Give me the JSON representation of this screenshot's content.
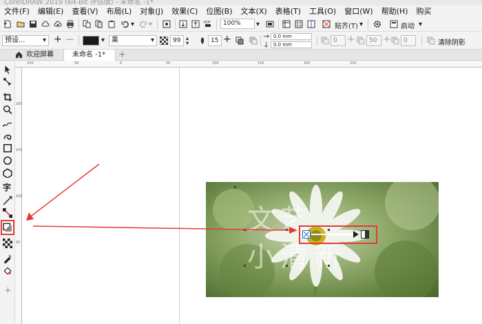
{
  "window": {
    "title": "CorelDRAW 2019 (64-Bit 评估版) - 未命名 -1*"
  },
  "menu": {
    "items": [
      "文件(F)",
      "编辑(E)",
      "查看(V)",
      "布局(L)",
      "对象(J)",
      "效果(C)",
      "位图(B)",
      "文本(X)",
      "表格(T)",
      "工具(O)",
      "窗口(W)",
      "帮助(H)",
      "购买"
    ]
  },
  "toolbar": {
    "zoom_value": "100%",
    "snap_label": "贴齐(T)",
    "launch_label": "启动"
  },
  "properties": {
    "preset_value": "预设...",
    "preset_add_symbol": "+",
    "preset_remove_symbol": "—",
    "direction_value": "乘",
    "opacity_value": "99",
    "feather_value": "15",
    "offset_x": "0.0 mm",
    "offset_y": "0.0 mm",
    "stretch_value": "0",
    "fade_value": "50",
    "extra_value": "0",
    "clear_shadow_label": "清除阴影"
  },
  "tabs": [
    {
      "label": "欢迎屏幕"
    },
    {
      "label": "未命名 -1*"
    }
  ],
  "rulers": {
    "h_labels": [
      "100",
      "50",
      "0",
      "50",
      "100",
      "150",
      "200",
      "250"
    ],
    "v_labels": [
      "200",
      "150",
      "100",
      "50"
    ]
  },
  "canvas": {
    "art_line1": "文艺",
    "art_line2": "小清新"
  },
  "colors": {
    "highlight": "#e53935",
    "fill_swatch": "#1a1a1a",
    "accent_blue": "#1f6fd1"
  }
}
